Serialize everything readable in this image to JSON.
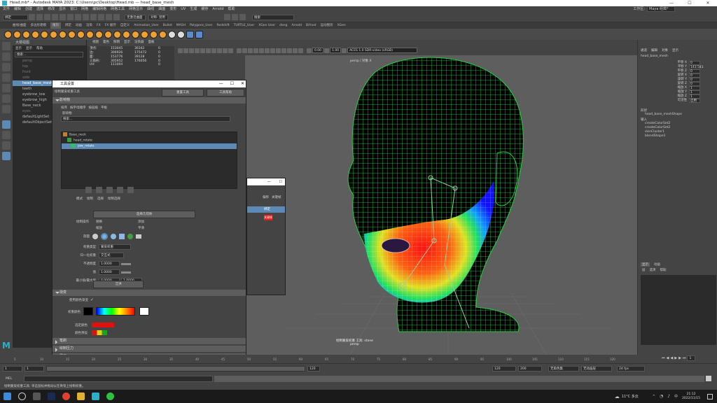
{
  "window": {
    "title": "Head.mb* - Autodesk MAYA 2023: C:\\Users\\pc\\Desktop\\Head.mb --- head_base_mesh"
  },
  "menus": [
    "文件",
    "编辑",
    "创建",
    "选择",
    "修改",
    "显示",
    "窗口",
    "网格",
    "编辑网格",
    "网格工具",
    "网格显示",
    "曲线",
    "曲面",
    "变形",
    "UV",
    "生成",
    "缓存",
    "Arnold",
    "帮助"
  ],
  "workspace": {
    "label": "工作区:",
    "value": "Maya 经典*"
  },
  "statusline": {
    "mode": "绑定",
    "object_label": "对象",
    "no_live": "无激活曲面",
    "symmetry": "对称: 禁用",
    "search": "搜索"
  },
  "shelf_tabs": [
    "曲线/曲面",
    "多边形建模",
    "雕刻",
    "绑定",
    "动画",
    "渲染",
    "FX",
    "FX 缓存",
    "自定义",
    "Animation_User",
    "Bullet",
    "MASH",
    "Polygons_User",
    "Redshift",
    "TURTLE_User",
    "XGen User",
    "deng",
    "Arnold",
    "Bifrost",
    "运动图形",
    "XGen"
  ],
  "outliner": {
    "title": "大纲视图",
    "menu": [
      "显示",
      "显示",
      "帮助"
    ],
    "search": "搜索...",
    "items": [
      "persp",
      "top",
      "front",
      "side",
      "head_base_mesh",
      "teeth",
      "eyebrow_low",
      "eyebrow_high",
      "Base_neck",
      "eyes",
      "defaultLightSet",
      "defaultObjectSet"
    ],
    "selected_index": 4
  },
  "stats": {
    "headers": [
      "",
      "",
      "",
      ""
    ],
    "rows": [
      [
        "顶点:",
        "153045",
        "36342",
        "0"
      ],
      [
        "边:",
        "306926",
        "175472",
        "0"
      ],
      [
        "面:",
        "153776",
        "39128",
        "0"
      ],
      [
        "三角形:",
        "305952",
        "176056",
        "0"
      ],
      [
        "UV:",
        "111004",
        "",
        "0"
      ]
    ]
  },
  "viewport": {
    "menus": [
      "视图",
      "着色",
      "照明",
      "显示",
      "渲染器",
      "面板"
    ],
    "camera_label": "persp / 对象 X",
    "exposure": "0.00",
    "gamma": "1.00",
    "colorspace": "ACES 1.0 SDR-video (sRGB)",
    "footer1": "绘制蒙皮权重 工具: stone",
    "footer2": "persp"
  },
  "tool_settings": {
    "title": "工具设置",
    "tool_name": "绘制蒙皮权重工具",
    "reset": "重置工具",
    "help": "工具帮助",
    "influence_section": "影响物",
    "sort_label": "排序",
    "sort_opts": [
      "按字母顺序",
      "按层级",
      "平板"
    ],
    "influence_sub": "影响物",
    "filter_placeholder": "搜索...",
    "influences": [
      "Base_neck",
      "head_rotate",
      "jaw_rotate"
    ],
    "influence_selected": 2,
    "mode_label": "模式",
    "mode_opts": [
      "绘制",
      "选择",
      "绘制选择"
    ],
    "select_geo": "选择几何体",
    "paint_op_label": "绘制操作",
    "paint_ops": [
      "替换",
      "添加",
      "缩放",
      "平滑"
    ],
    "profile_label": "剖面",
    "weight_type_label": "权重类型",
    "weight_type": "蒙皮权重",
    "normalize_label": "归一化权重",
    "normalize": "交互式",
    "opacity_label": "不透明度",
    "opacity": "1.0000",
    "value_label": "值",
    "value": "1.0000",
    "minmax_label": "最小值/最大值",
    "min": "0.0000",
    "max": "1.0000",
    "flood": "泛洪",
    "gradient_section": "渐变",
    "use_color_ramp": "使用颜色渐变",
    "weight_color_label": "权重颜色",
    "selected_color_label": "选定颜色",
    "color_preset_label": "颜色预设",
    "closed_sections": [
      "笔刷",
      "绘制压力",
      "显示"
    ]
  },
  "popup": {
    "tabs": [
      "偏移",
      "关键帧"
    ],
    "labels": [
      "绑定",
      "关键帧"
    ]
  },
  "channel_box": {
    "menus": [
      "通道",
      "编辑",
      "对象",
      "显示"
    ],
    "object": "head_base_mesh",
    "attrs": [
      "平移 X",
      "平移 Y",
      "平移 Z",
      "旋转 X",
      "旋转 Y",
      "旋转 Z",
      "缩放 X",
      "缩放 Y",
      "缩放 Z",
      "可见性"
    ],
    "values": [
      "0",
      "143.541",
      "0",
      "0",
      "0",
      "0",
      "1",
      "1",
      "1",
      "启用"
    ],
    "shapes_label": "形状",
    "shape": "head_base_meshShape",
    "inputs_label": "输入",
    "inputs": [
      "createColorSet2",
      "createColorSet2",
      "skinCluster1",
      "blendShape1"
    ],
    "layers_menu": [
      "显示",
      "动画"
    ],
    "layers_sub": [
      "层",
      "选项",
      "帮助"
    ]
  },
  "time": {
    "ticks": [
      "5",
      "10",
      "15",
      "20",
      "25",
      "30",
      "35",
      "40",
      "45",
      "50",
      "55",
      "60",
      "65",
      "70",
      "75",
      "80",
      "85",
      "90",
      "95",
      "100",
      "105",
      "110",
      "115",
      "120"
    ],
    "start": "1",
    "current": "1",
    "range_start": "1",
    "range_end": "120",
    "end": "120",
    "anim_end": "200",
    "char_set": "无角色集",
    "anim_layer": "无动画层",
    "fps": "24 fps"
  },
  "mel": {
    "label": "MEL",
    "help": "绘制蒙皮权重工具: 单击鼠标并拖动以在骨架上绘制权重。"
  },
  "taskbar": {
    "temp": "11°C 多云",
    "clock": "21:12",
    "date": "2022/11/15"
  },
  "colors": {
    "accent": "#5d8ab5",
    "mesh_green": "#22d040",
    "maya_teal": "#2ab0c8"
  }
}
